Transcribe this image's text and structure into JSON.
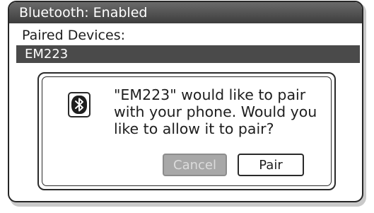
{
  "title_bar": {
    "text": "Bluetooth: Enabled"
  },
  "paired_devices": {
    "label": "Paired Devices:",
    "items": [
      {
        "name": "EM223",
        "selected": true
      }
    ]
  },
  "dialog": {
    "icon": "bluetooth-icon",
    "message": "\"EM223\" would like to pair\nwith your phone. Would you\nlike to allow it to pair?",
    "cancel_label": "Cancel",
    "pair_label": "Pair"
  },
  "colors": {
    "title_bar": "#4a4a4a",
    "selected_row": "#4a4a4a",
    "disabled_button": "#a8a8a8"
  }
}
